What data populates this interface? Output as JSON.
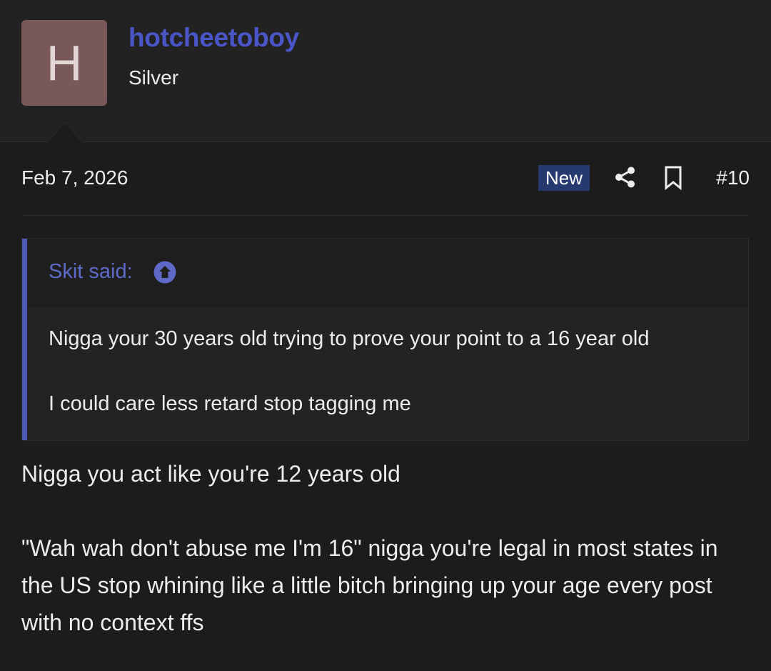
{
  "user": {
    "avatar_letter": "H",
    "avatar_color": "#785858",
    "username": "hotcheetoboy",
    "username_color": "#4a55c8",
    "title": "Silver"
  },
  "post": {
    "date": "Feb 7, 2026",
    "badge": "New",
    "share_icon": "share-icon",
    "bookmark_icon": "bookmark-icon",
    "number": "#10"
  },
  "quote": {
    "author_label": "Skit said:",
    "jump_icon": "arrow-up-circle-icon",
    "accent_color": "#4f59b8",
    "lines": [
      "Nigga your 30 years old trying to prove your point to a 16 year old",
      "I could care less retard stop tagging me"
    ]
  },
  "body": {
    "paragraph_1": "Nigga you act like you're 12 years old",
    "paragraph_2": "\"Wah wah don't abuse me I'm 16\" nigga you're legal in most states in the US stop whining like a little bitch bringing up your age every post with no context ffs"
  }
}
